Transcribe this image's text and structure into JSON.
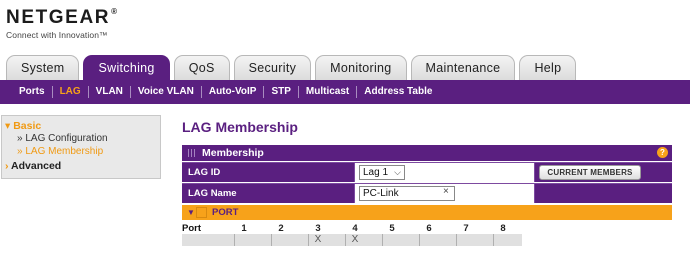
{
  "brand": {
    "name": "NETGEAR",
    "reg": "®",
    "tagline": "Connect with Innovation™"
  },
  "tabs": [
    {
      "label": "System",
      "active": false
    },
    {
      "label": "Switching",
      "active": true
    },
    {
      "label": "QoS",
      "active": false
    },
    {
      "label": "Security",
      "active": false
    },
    {
      "label": "Monitoring",
      "active": false
    },
    {
      "label": "Maintenance",
      "active": false
    },
    {
      "label": "Help",
      "active": false
    }
  ],
  "subnav": [
    {
      "label": "Ports",
      "active": false
    },
    {
      "label": "LAG",
      "active": true
    },
    {
      "label": "VLAN",
      "active": false
    },
    {
      "label": "Voice VLAN",
      "active": false
    },
    {
      "label": "Auto-VoIP",
      "active": false
    },
    {
      "label": "STP",
      "active": false
    },
    {
      "label": "Multicast",
      "active": false
    },
    {
      "label": "Address Table",
      "active": false
    }
  ],
  "leftnav": {
    "basic": "Basic",
    "items": [
      {
        "label": "LAG Configuration",
        "active": false
      },
      {
        "label": "LAG Membership",
        "active": true
      }
    ],
    "advanced": "Advanced"
  },
  "page": {
    "title": "LAG Membership"
  },
  "panel": {
    "title": "Membership",
    "help": "?",
    "lag_id_label": "LAG ID",
    "lag_id_value": "Lag 1",
    "lag_name_label": "LAG Name",
    "lag_name_value": "PC-Link",
    "clear": "×",
    "current_members_button": "CURRENT MEMBERS"
  },
  "ports": {
    "section_label": "PORT",
    "row_label": "Port",
    "numbers": [
      "1",
      "2",
      "3",
      "4",
      "5",
      "6",
      "7",
      "8"
    ],
    "selected": [
      "",
      "",
      "X",
      "X",
      "",
      "",
      "",
      ""
    ]
  },
  "colors": {
    "purple": "#5a1f80",
    "orange": "#f7a21a"
  }
}
